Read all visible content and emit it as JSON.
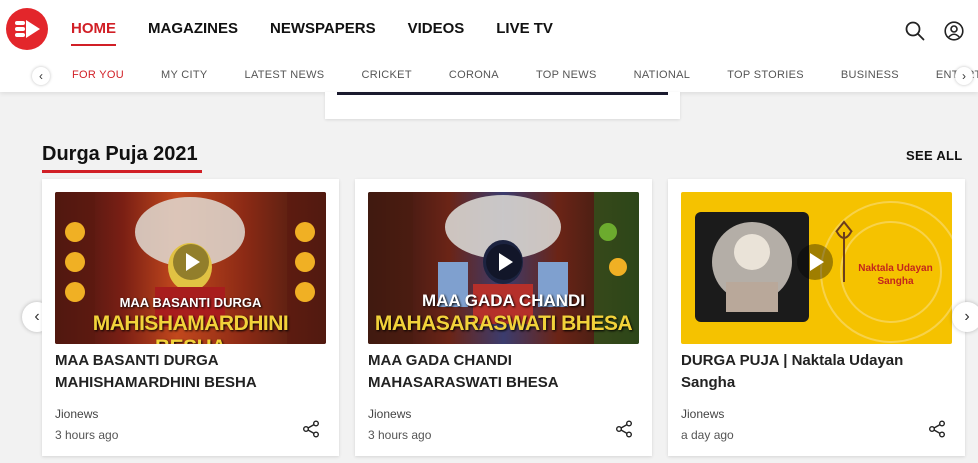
{
  "header": {
    "nav": [
      "HOME",
      "MAGAZINES",
      "NEWSPAPERS",
      "VIDEOS",
      "LIVE TV"
    ],
    "active_nav": "HOME",
    "icons": {
      "logo": "jionews-logo",
      "search": "search-icon",
      "profile": "user-icon"
    }
  },
  "subnav": {
    "items": [
      "FOR YOU",
      "MY CITY",
      "LATEST NEWS",
      "CRICKET",
      "CORONA",
      "TOP NEWS",
      "NATIONAL",
      "TOP STORIES",
      "BUSINESS",
      "ENTERT"
    ],
    "active": "FOR YOU",
    "left_arrow": "‹",
    "right_arrow": "›"
  },
  "section": {
    "title": "Durga Puja 2021",
    "see_all": "SEE ALL",
    "prev_arrow": "‹",
    "next_arrow": "›"
  },
  "cards": [
    {
      "title": "MAA BASANTI DURGA MAHISHAMARDHINI BESHA",
      "thumb_small": "MAA BASANTI DURGA",
      "thumb_big": "MAHISHAMARDHINI BESHA",
      "source": "Jionews",
      "time": "3 hours ago"
    },
    {
      "title": "MAA GADA CHANDI MAHASARASWATI BHESA",
      "thumb_small": "MAA GADA CHANDI",
      "thumb_big": "MAHASARASWATI BHESA",
      "source": "Jionews",
      "time": "3 hours ago"
    },
    {
      "title": "DURGA PUJA | Naktala Udayan Sangha",
      "thumb_text": "Naktala Udayan Sangha",
      "source": "Jionews",
      "time": "a day ago"
    }
  ],
  "colors": {
    "brand_red": "#e3262b",
    "active_red": "#d11f26",
    "thumb_yellow": "#f5c200"
  }
}
